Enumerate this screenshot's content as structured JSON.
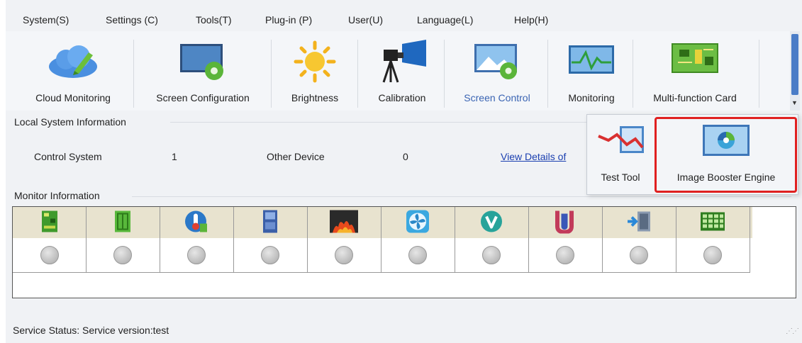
{
  "menu": [
    "System(S)",
    "Settings (C)",
    "Tools(T)",
    "Plug-in (P)",
    "User(U)",
    "Language(L)",
    "Help(H)"
  ],
  "toolbar": {
    "items": [
      {
        "label": "Cloud Monitoring",
        "icon": "cloud-edit-icon"
      },
      {
        "label": "Screen Configuration",
        "icon": "screen-gear-icon"
      },
      {
        "label": "Brightness",
        "icon": "sun-icon"
      },
      {
        "label": "Calibration",
        "icon": "camera-tripod-icon"
      },
      {
        "label": "Screen Control",
        "icon": "picture-gear-icon",
        "active": true
      },
      {
        "label": "Monitoring",
        "icon": "waveform-monitor-icon"
      },
      {
        "label": "Multi-function Card",
        "icon": "circuit-board-icon"
      }
    ],
    "active_color": "#3a64b3"
  },
  "local_system": {
    "title": "Local System Information",
    "control_system_label": "Control System",
    "control_system_value": "1",
    "other_device_label": "Other Device",
    "other_device_value": "0",
    "view_details_link": "View Details of"
  },
  "monitor": {
    "title": "Monitor Information",
    "columns": [
      "board-icon",
      "card-icon",
      "thermometer-icon",
      "chip-icon",
      "fire-icon",
      "fan-icon",
      "v-badge-icon",
      "cable-icon",
      "door-icon",
      "grid-module-icon"
    ],
    "status": "unknown"
  },
  "status_bar": {
    "text": "Service Status:  Service version:test"
  },
  "popup": {
    "items": [
      {
        "label": "Test Tool",
        "icon": "chart-test-icon"
      },
      {
        "label": "Image Booster Engine",
        "icon": "image-booster-icon",
        "highlighted": true
      }
    ],
    "highlight_color": "#e02020"
  }
}
